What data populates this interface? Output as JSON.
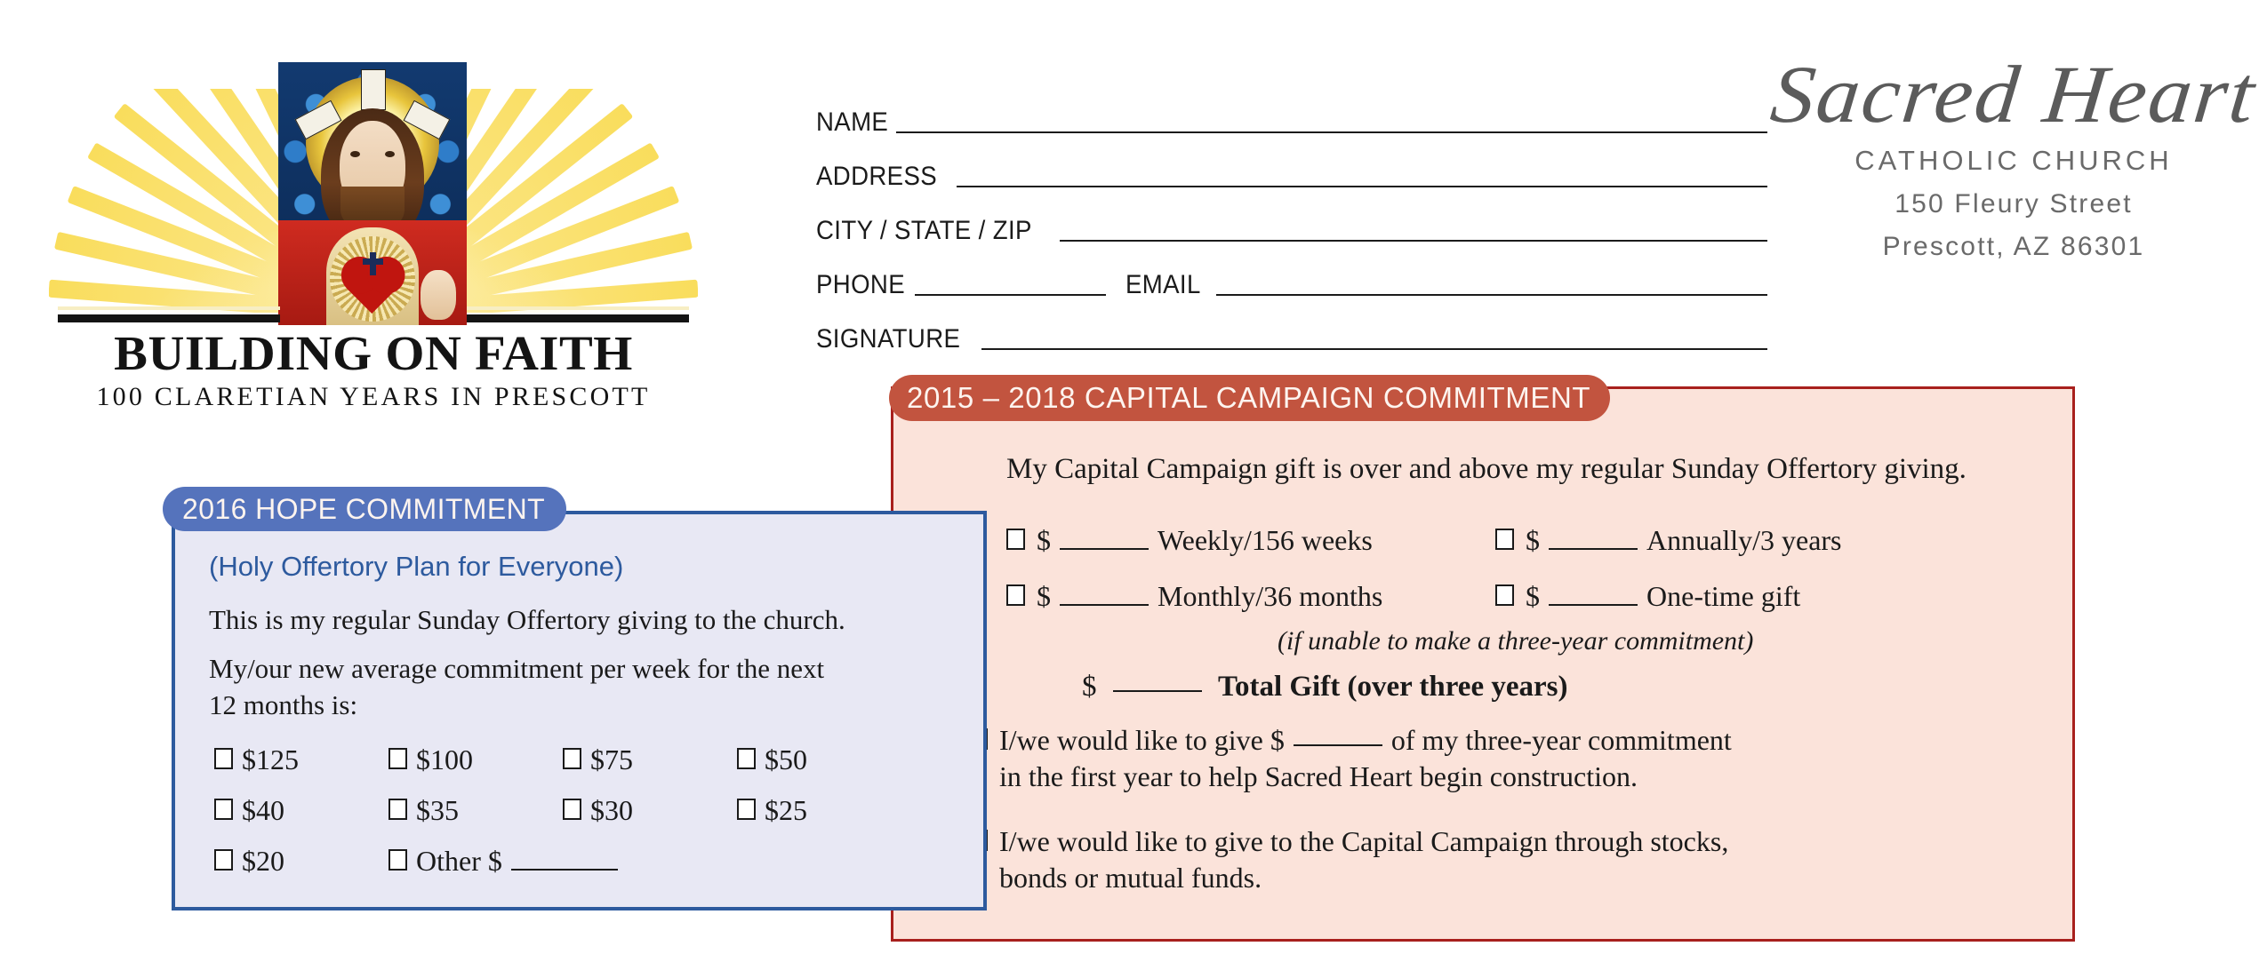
{
  "logo": {
    "title": "BUILDING ON FAITH",
    "subtitle": "100 CLARETIAN YEARS IN PRESCOTT",
    "image_alt": "sacred-heart-of-jesus-stained-glass"
  },
  "form": {
    "fields": [
      {
        "label": "NAME"
      },
      {
        "label": "ADDRESS"
      },
      {
        "label": "CITY / STATE / ZIP"
      },
      {
        "label": "PHONE",
        "label2": "EMAIL"
      },
      {
        "label": "SIGNATURE"
      }
    ]
  },
  "church": {
    "script_name": "Sacred Heart",
    "subtitle": "CATHOLIC CHURCH",
    "address_line1": "150 Fleury Street",
    "address_line2": "Prescott, AZ  86301"
  },
  "hope_panel": {
    "tab_label": "2016 HOPE COMMITMENT",
    "subtitle": "(Holy Offertory Plan for Everyone)",
    "line1": "This is my regular Sunday Offertory giving to the church.",
    "line2": "My/our new average commitment per week for the next 12 months is:",
    "amounts_row1": [
      "$125",
      "$100",
      "$75",
      "$50"
    ],
    "amounts_row2": [
      "$40",
      "$35",
      "$30",
      "$25"
    ],
    "amounts_row3": [
      "$20"
    ],
    "other_label": "Other $",
    "tab_color": "#5573bc",
    "fill_color": "#e8e8f4",
    "border_color": "#2d5a9e",
    "accent_text_color": "#2d5a9e"
  },
  "capital_panel": {
    "tab_label": "2015 – 2018 CAPITAL CAMPAIGN COMMITMENT",
    "intro": "My Capital Campaign gift is over and above my regular Sunday Offertory giving.",
    "options": [
      {
        "prefix": "$",
        "suffix": "Weekly/156 weeks"
      },
      {
        "prefix": "$",
        "suffix": "Annually/3 years"
      },
      {
        "prefix": "$",
        "suffix": "Monthly/36 months"
      },
      {
        "prefix": "$",
        "suffix": "One-time gift"
      }
    ],
    "note": "(if unable to make a three-year commitment)",
    "total_prefix": "$",
    "total_label": "Total Gift",
    "total_suffix": "(over three years)",
    "statement1_part1": "I/we would like to give $",
    "statement1_part2": "of my three-year commitment",
    "statement1_line2": "in the first year to help Sacred Heart begin construction.",
    "statement2_line1": "I/we would like to give to the Capital Campaign through stocks,",
    "statement2_line2": "bonds or mutual funds.",
    "tab_color": "#c2543f",
    "fill_color": "#fbe3da",
    "border_color": "#a8201d"
  }
}
